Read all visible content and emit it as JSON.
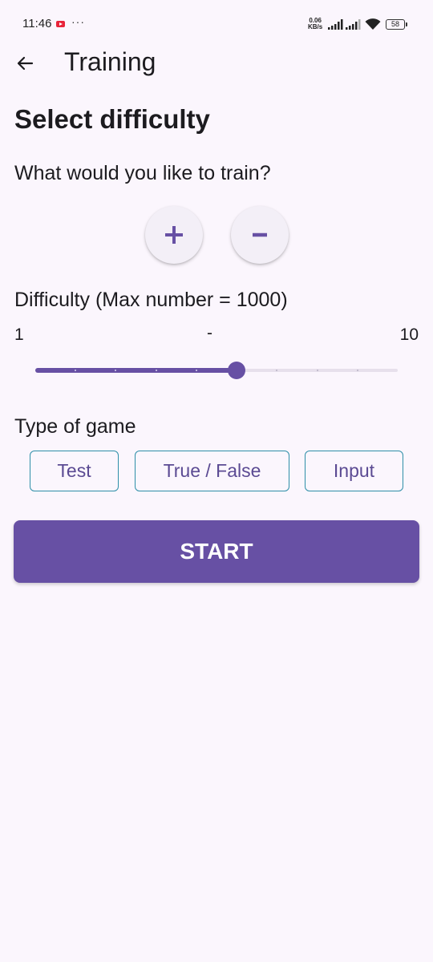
{
  "status_bar": {
    "time": "11:46",
    "more": "···",
    "speed_value": "0.06",
    "speed_unit": "KB/s",
    "battery": "58"
  },
  "app_bar": {
    "title": "Training",
    "back_icon": "arrow-left-icon"
  },
  "content": {
    "heading": "Select difficulty",
    "question": "What would you like to train?",
    "operations": [
      {
        "label": "+",
        "icon": "plus-icon"
      },
      {
        "label": "−",
        "icon": "minus-icon"
      }
    ],
    "difficulty_label": "Difficulty (Max number = 1000)",
    "range_min": "1",
    "range_mid": "-",
    "range_max": "10",
    "slider": {
      "min": 1,
      "max": 10,
      "value": 6
    },
    "type_label": "Type of game",
    "game_types": [
      "Test",
      "True / False",
      "Input"
    ],
    "start_label": "START"
  },
  "colors": {
    "primary": "#6750a4",
    "background": "#fbf6fd",
    "chip_border": "#2e8fa8"
  }
}
